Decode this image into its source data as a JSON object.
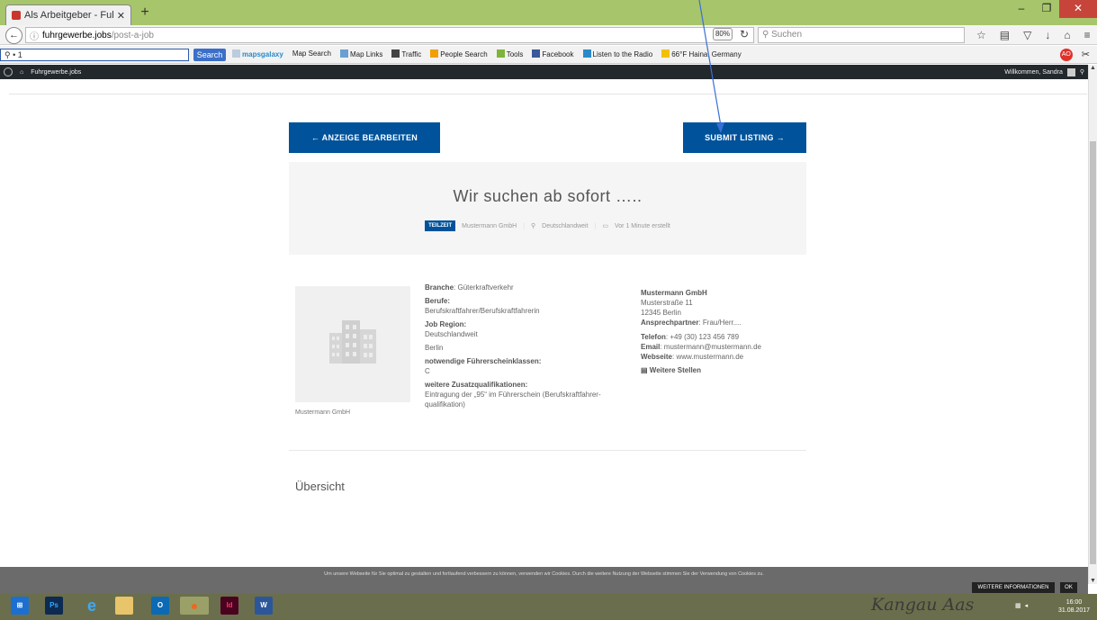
{
  "browser": {
    "tab_title": "Als Arbeitgeber - Fuhrgewer",
    "tab_close": "✕",
    "new_tab": "+",
    "url_domain": "fuhrgewerbe.jobs",
    "url_path": "/post-a-job",
    "zoom": "80%",
    "search_placeholder": "Suchen",
    "window_min": "–",
    "window_max": "❐",
    "window_close": "✕"
  },
  "toolbar": {
    "search_value": "1",
    "search_button": "Search",
    "links": [
      "mapsgalaxy",
      "Map Search",
      "Map Links",
      "Traffic",
      "People Search",
      "Tools",
      "Facebook",
      "Listen to the Radio",
      "66°F Haina, Germany"
    ]
  },
  "adminbar": {
    "site": "Fuhrgewerbe.jobs",
    "welcome": "Willkommen, Sandra"
  },
  "page": {
    "edit_button": "← ANZEIGE BEARBEITEN",
    "submit_button": "SUBMIT LISTING →",
    "job_title": "Wir suchen ab sofort …..",
    "badge": "TEILZEIT",
    "company": "Mustermann GmbH",
    "location": "Deutschlandweit",
    "created": "Vor 1 Minute erstellt",
    "logo_caption": "Mustermann GmbH",
    "details": {
      "branche_label": "Branche",
      "branche": "Güterkraftverkehr",
      "berufe_label": "Berufe:",
      "berufe": "Berufskraftfahrer/Berufskraftfahrerin",
      "region_label": "Job Region:",
      "region_1": "Deutschlandweit",
      "region_2": "Berlin",
      "fuehrerschein_label": "notwendige Führerscheinklassen:",
      "fuehrerschein": "C",
      "zusatz_label": "weitere Zusatzqualifikationen:",
      "zusatz": "Eintragung der „95“ im Führerschein (Berufskraftfahrer-qualifikation)"
    },
    "contact": {
      "name": "Mustermann GmbH",
      "street": "Musterstraße 11",
      "city": "12345 Berlin",
      "person_label": "Ansprechpartner",
      "person": "Frau/Herr....",
      "phone_label": "Telefon",
      "phone": "+49 (30) 123 456 789",
      "email_label": "Email",
      "email": "mustermann@mustermann.de",
      "web_label": "Webseite",
      "web": "www.mustermann.de",
      "more": "Weitere Stellen"
    },
    "overview": "Übersicht"
  },
  "cookie": {
    "text": "Um unsere Webseite für Sie optimal zu gestalten und fortlaufend verbessern zu können, verwenden wir Cookies. Durch die weitere Nutzung der Webseite stimmen Sie der Verwendung von Cookies zu.",
    "more": "WEITERE INFORMATIONEN",
    "ok": "OK"
  },
  "taskbar": {
    "time": "16:00",
    "date": "31.08.2017",
    "signature": "Kangau Aas"
  },
  "colors": {
    "brand": "#00529b",
    "tabbar": "#a7c56b",
    "adminbar": "#23282d",
    "annotation": "#3a6fd8"
  }
}
